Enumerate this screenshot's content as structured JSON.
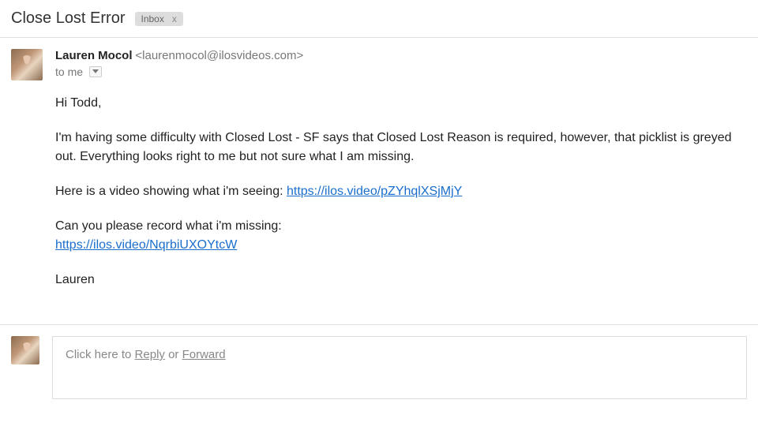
{
  "header": {
    "subject": "Close Lost Error",
    "label": "Inbox"
  },
  "message": {
    "sender_name": "Lauren Mocol",
    "sender_email": "<laurenmocol@ilosvideos.com>",
    "to_text": "to me",
    "body": {
      "greeting": "Hi Todd,",
      "p1": "I'm having some difficulty with Closed Lost - SF says that Closed Lost Reason is required, however, that picklist is greyed out. Everything looks right to me but not sure what I am missing.",
      "p2_pre": "Here is a video showing what i'm seeing: ",
      "p2_link": "https://ilos.video/pZYhqlXSjMjY",
      "p3": "Can you please record what i'm missing:",
      "p3_link": "https://ilos.video/NqrbiUXOYtcW",
      "signoff": "Lauren"
    }
  },
  "reply": {
    "prefix": "Click here to ",
    "reply_text": "Reply",
    "or_text": " or ",
    "forward_text": "Forward"
  }
}
